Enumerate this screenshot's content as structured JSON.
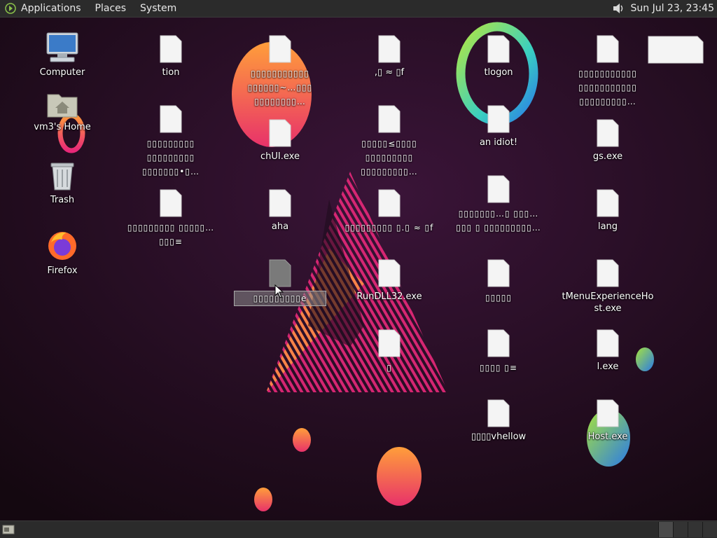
{
  "top_panel": {
    "menus": [
      "Applications",
      "Places",
      "System"
    ],
    "clock": "Sun Jul 23, 23:45",
    "volume_icon": "speaker-icon"
  },
  "desktop": {
    "system_icons": [
      {
        "label": "Computer",
        "icon": "computer-icon"
      },
      {
        "label": "vm3's Home",
        "icon": "home-folder-icon"
      },
      {
        "label": "Trash",
        "icon": "trash-icon"
      },
      {
        "label": "Firefox",
        "icon": "firefox-icon"
      }
    ],
    "files": [
      {
        "label": "tion"
      },
      {
        "label": "▯▯▯▯▯▯▯▯▯▯▯ ▯▯▯▯▯▯~…▯▯▯ ▯▯▯▯▯▯▯▯…"
      },
      {
        "label": ",▯ ≈ ▯f"
      },
      {
        "label": "tlogon"
      },
      {
        "label": "▯▯▯▯▯▯▯▯▯▯▯ ▯▯▯▯▯▯▯▯▯▯▯ ▯▯▯▯▯▯▯▯▯…"
      },
      {
        "label": "▯▯▯▯▯▯▯▯▯ ▯▯▯▯▯▯▯▯▯ ▯▯▯▯▯▯▯•▯…"
      },
      {
        "label": "chUI.exe"
      },
      {
        "label": "▯▯▯▯▯≤▯▯▯▯ ▯▯▯▯▯▯▯▯▯ ▯▯▯▯▯▯▯▯▯…"
      },
      {
        "label": "an idiot!"
      },
      {
        "label": "gs.exe"
      },
      {
        "label": "▯▯▯▯▯▯▯▯▯ ▯▯▯▯▯…▯▯▯≡"
      },
      {
        "label": "aha"
      },
      {
        "label": "▯▯▯▯▯▯▯▯▯ ▯.▯ ≈ ▯f"
      },
      {
        "label": "▯▯▯▯▯▯▯…▯ ▯▯▯…▯▯▯ ▯ ▯▯▯▯▯▯▯▯▯…"
      },
      {
        "label": "lang"
      },
      {
        "label": "▯▯▯▯▯▯▯▯▯e"
      },
      {
        "label": "RunDLL32.exe"
      },
      {
        "label": "▯▯▯▯▯"
      },
      {
        "label": "tMenuExperienceHost.exe"
      },
      {
        "label": "▯"
      },
      {
        "label": "▯▯▯▯ ▯≡"
      },
      {
        "label": "l.exe"
      },
      {
        "label": "▯▯▯▯vhellow"
      },
      {
        "label": "Host.exe"
      }
    ]
  },
  "colors": {
    "panel": "#2b2b2b",
    "background": "#1e0c1c",
    "accent_pink": "#e8287a",
    "accent_orange": "#ff9a3c"
  },
  "bottom_panel": {
    "show_desktop_icon": "show-desktop-icon",
    "workspace_count": 4
  }
}
